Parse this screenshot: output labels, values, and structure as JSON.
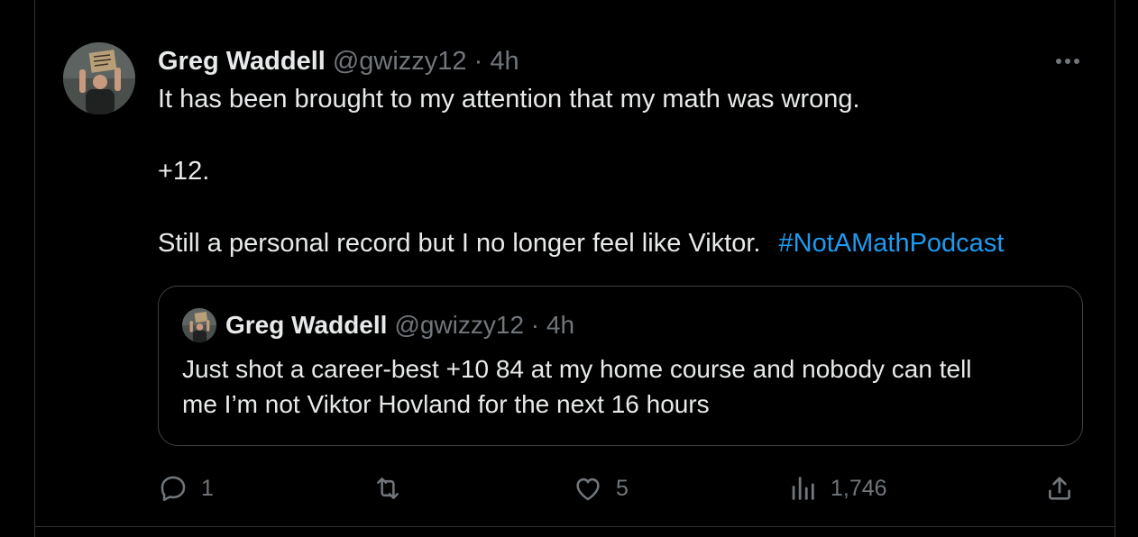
{
  "tweet": {
    "author_name": "Greg Waddell",
    "author_handle_time": "@gwizzy12 · 4h",
    "line1": "It has been brought to my attention that my math was wrong.",
    "line2": "+12.",
    "line3": "Still a personal record but I no longer feel like Viktor.",
    "hashtag": "#NotAMathPodcast",
    "more_icon": "more-horizontal-icon"
  },
  "quoted": {
    "author_name": "Greg Waddell",
    "author_handle_time": "@gwizzy12 · 4h",
    "line1": "Just shot a career-best +10 84 at my home course and nobody can tell",
    "line2": "me I’m not Viktor Hovland for the next 16 hours"
  },
  "actions": {
    "reply_count": "1",
    "retweet_count": "",
    "like_count": "5",
    "view_count": "1,746"
  },
  "colors": {
    "background": "#000000",
    "text": "#e7e9ea",
    "secondary": "#71767b",
    "link": "#1d9bf0",
    "border": "#2f3336"
  }
}
